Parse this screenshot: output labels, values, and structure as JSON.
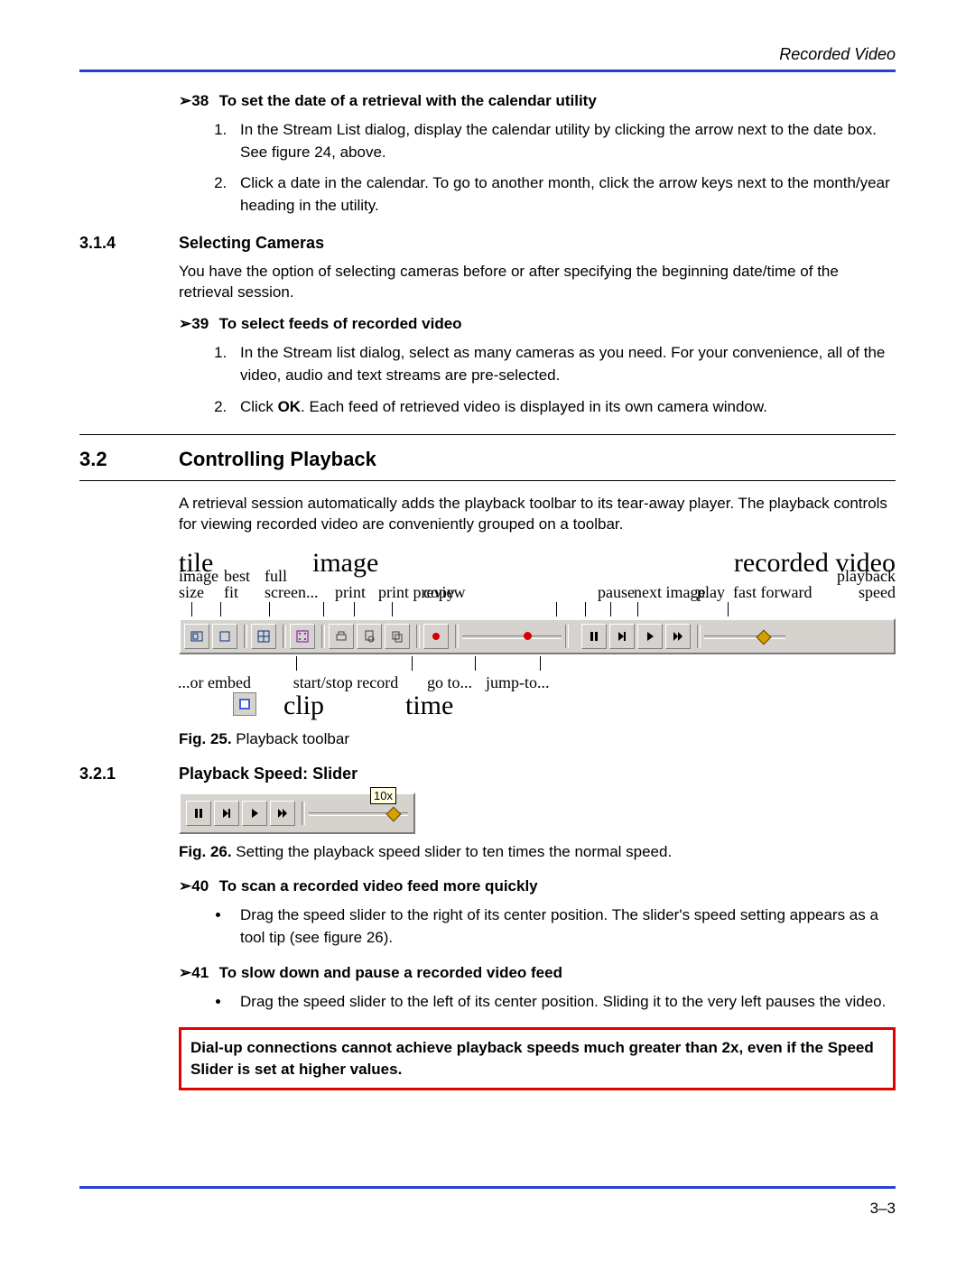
{
  "header": {
    "running_title": "Recorded Video"
  },
  "proc38": {
    "heading_prefix": "➢38",
    "heading": "To set the date of a retrieval with the calendar utility",
    "steps": [
      "In the Stream List dialog, display the calendar utility by clicking the arrow next to the date box. See figure 24, above.",
      "Click a date in the calendar. To go to another month, click the arrow keys next to the month/year heading in the utility."
    ]
  },
  "sec314": {
    "number": "3.1.4",
    "title": "Selecting Cameras",
    "intro": "You have the option of selecting cameras before or after specifying the beginning date/time of the retrieval session."
  },
  "proc39": {
    "heading_prefix": "➢39",
    "heading": "To select feeds of recorded video",
    "step1": "In the Stream list dialog, select as many cameras as you need. For your convenience, all of the video, audio and text streams are pre-selected.",
    "step2_pre": "Click ",
    "step2_bold": "OK",
    "step2_post": ". Each feed of retrieved video is displayed in its own  camera window."
  },
  "sec32": {
    "number": "3.2",
    "title": "Controlling Playback",
    "intro": "A retrieval session automatically adds the playback toolbar to its tear-away player. The playback controls for viewing recorded video are conveniently grouped on a toolbar."
  },
  "fig25": {
    "caption_label": "Fig. 25.",
    "caption_text": " Playback toolbar",
    "top_groups": {
      "tile": "tile",
      "image": "image",
      "recorded": "recorded video"
    },
    "labels_top": {
      "image_size": "image\nsize",
      "best_fit": "best\nfit",
      "full_screen": "full\nscreen...",
      "print": "print",
      "print_preview": "print preview",
      "copy": "copy",
      "pause": "pause",
      "next_image": "next image",
      "play": "play",
      "fast_forward": "fast forward",
      "playback_speed": "playback speed"
    },
    "labels_bottom": {
      "or_embed": "...or embed",
      "start_stop": "start/stop record",
      "clip": "clip",
      "go_to": "go to...",
      "time": "time",
      "jump_to": "jump-to..."
    }
  },
  "sec321": {
    "number": "3.2.1",
    "title": "Playback Speed: Slider"
  },
  "fig26": {
    "tooltip": "10x",
    "caption_label": "Fig. 26.",
    "caption_text": " Setting the playback speed slider to ten times the normal speed."
  },
  "proc40": {
    "heading_prefix": "➢40",
    "heading": "To scan a recorded video feed more quickly",
    "bullet": "Drag the speed slider to the right of its center position. The slider's speed setting appears as a tool tip (see figure 26)."
  },
  "proc41": {
    "heading_prefix": "➢41",
    "heading": "To slow down and pause a recorded video feed",
    "bullet": "Drag the speed slider to the left of its center position. Sliding it to the very left pauses the video."
  },
  "note": "Dial-up connections cannot achieve playback speeds much greater than 2x, even if the Speed Slider is set at higher values.",
  "page_number": "3–3"
}
